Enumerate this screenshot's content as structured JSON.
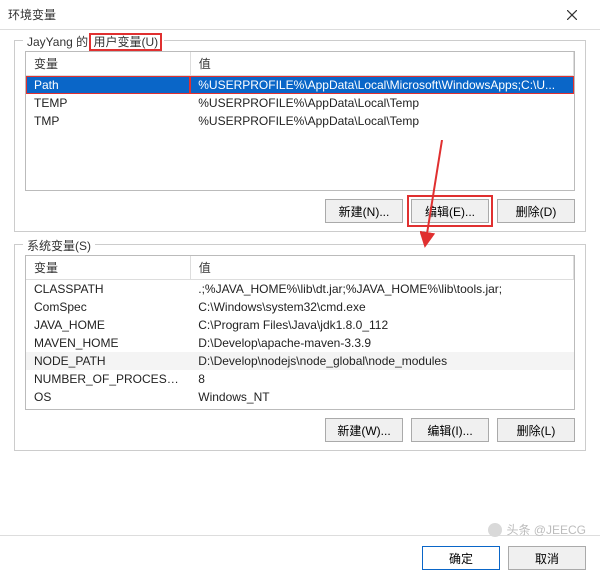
{
  "window": {
    "title": "环境变量",
    "close_name": "close"
  },
  "user_group": {
    "label_prefix": "JayYang 的 ",
    "label_highlight": "用户变量(U)",
    "headers": {
      "name": "变量",
      "value": "值"
    },
    "rows": [
      {
        "name": "Path",
        "value": "%USERPROFILE%\\AppData\\Local\\Microsoft\\WindowsApps;C:\\U..."
      },
      {
        "name": "TEMP",
        "value": "%USERPROFILE%\\AppData\\Local\\Temp"
      },
      {
        "name": "TMP",
        "value": "%USERPROFILE%\\AppData\\Local\\Temp"
      }
    ],
    "buttons": {
      "new": "新建(N)...",
      "edit": "编辑(E)...",
      "delete": "删除(D)"
    }
  },
  "system_group": {
    "label": "系统变量(S)",
    "headers": {
      "name": "变量",
      "value": "值"
    },
    "rows": [
      {
        "name": "CLASSPATH",
        "value": ".;%JAVA_HOME%\\lib\\dt.jar;%JAVA_HOME%\\lib\\tools.jar;"
      },
      {
        "name": "ComSpec",
        "value": "C:\\Windows\\system32\\cmd.exe"
      },
      {
        "name": "JAVA_HOME",
        "value": "C:\\Program Files\\Java\\jdk1.8.0_112"
      },
      {
        "name": "MAVEN_HOME",
        "value": "D:\\Develop\\apache-maven-3.3.9"
      },
      {
        "name": "NODE_PATH",
        "value": "D:\\Develop\\nodejs\\node_global\\node_modules"
      },
      {
        "name": "NUMBER_OF_PROCESSORS",
        "value": "8"
      },
      {
        "name": "OS",
        "value": "Windows_NT"
      }
    ],
    "buttons": {
      "new": "新建(W)...",
      "edit": "编辑(I)...",
      "delete": "删除(L)"
    }
  },
  "footer": {
    "ok": "确定",
    "cancel": "取消"
  },
  "watermark": {
    "text": "头条 @JEECG"
  }
}
